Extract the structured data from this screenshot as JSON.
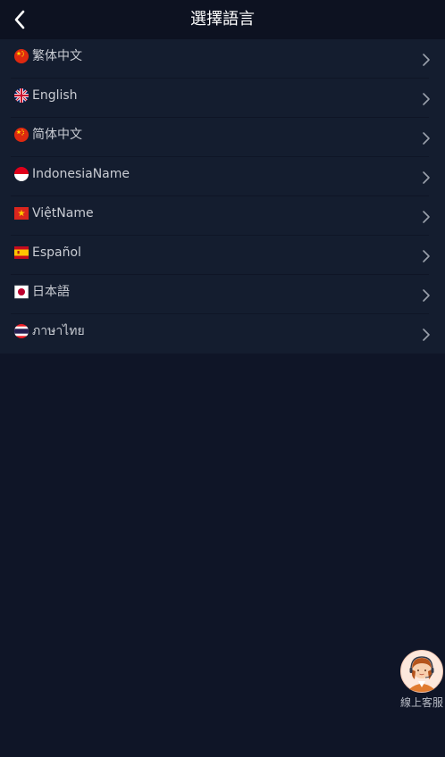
{
  "header": {
    "title": "選擇語言",
    "back_icon": "chevron-left-icon"
  },
  "languages": [
    {
      "label": "繁体中文",
      "flag": "china-flag-icon"
    },
    {
      "label": "English",
      "flag": "uk-flag-icon"
    },
    {
      "label": "简体中文",
      "flag": "china-flag-icon"
    },
    {
      "label": "IndonesiaName",
      "flag": "indonesia-flag-icon"
    },
    {
      "label": "ViệtName",
      "flag": "vietnam-flag-icon"
    },
    {
      "label": "Español",
      "flag": "spain-flag-icon"
    },
    {
      "label": "日本語",
      "flag": "japan-flag-icon"
    },
    {
      "label": "ภาษาไทย",
      "flag": "thailand-flag-icon"
    }
  ],
  "customer_service": {
    "label": "線上客服",
    "icon": "support-agent-avatar-icon"
  },
  "colors": {
    "background": "#0f1527",
    "header": "#0d1221",
    "list": "#141d2f",
    "text": "#c9ccd3"
  }
}
